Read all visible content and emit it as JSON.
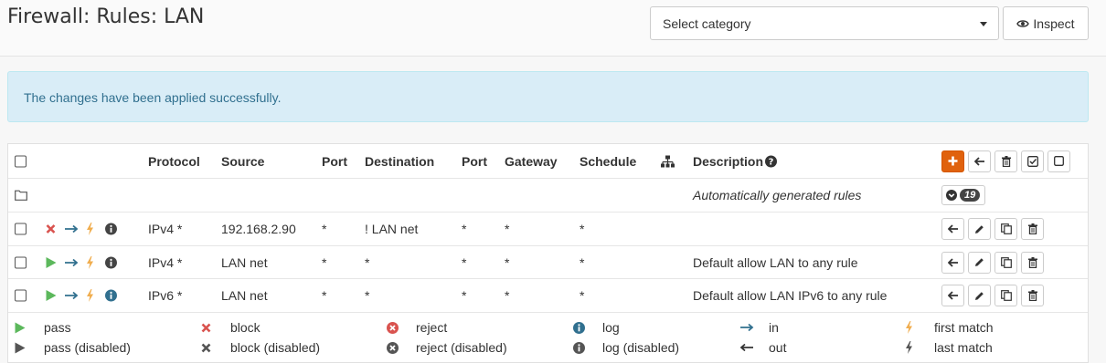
{
  "header": {
    "title": "Firewall: Rules: LAN",
    "category_placeholder": "Select category",
    "inspect_label": "Inspect"
  },
  "alert": {
    "message": "The changes have been applied successfully."
  },
  "table": {
    "columns": {
      "protocol": "Protocol",
      "source": "Source",
      "port": "Port",
      "destination": "Destination",
      "port2": "Port",
      "gateway": "Gateway",
      "schedule": "Schedule",
      "description": "Description"
    },
    "auto_rules": {
      "description": "Automatically generated rules",
      "count": "19"
    },
    "rows": [
      {
        "action": "block",
        "protocol": "IPv4 *",
        "source": "192.168.2.90",
        "port": "*",
        "destination": "! LAN net",
        "port2": "*",
        "gateway": "*",
        "schedule": "*",
        "description": ""
      },
      {
        "action": "pass",
        "protocol": "IPv4 *",
        "source": "LAN net",
        "port": "*",
        "destination": "*",
        "port2": "*",
        "gateway": "*",
        "schedule": "*",
        "description": "Default allow LAN to any rule"
      },
      {
        "action": "pass",
        "protocol": "IPv6 *",
        "source": "LAN net",
        "port": "*",
        "destination": "*",
        "port2": "*",
        "gateway": "*",
        "schedule": "*",
        "description": "Default allow LAN IPv6 to any rule"
      }
    ]
  },
  "legend": {
    "pass": "pass",
    "pass_disabled": "pass (disabled)",
    "block": "block",
    "block_disabled": "block (disabled)",
    "reject": "reject",
    "reject_disabled": "reject (disabled)",
    "log": "log",
    "log_disabled": "log (disabled)",
    "in": "in",
    "out": "out",
    "first_match": "first match",
    "last_match": "last match"
  },
  "colors": {
    "pass": "#5cb85c",
    "block": "#d9534f",
    "direction": "#31708f",
    "quick": "#f0ad4e",
    "info": "#444444",
    "info_log": "#31708f",
    "accent": "#e0620d",
    "alert_bg": "#d9edf7"
  },
  "icons": {
    "inspect": "eye-icon",
    "category_dropdown": "caret-down-icon",
    "add": "plus-icon",
    "move": "arrow-left-icon",
    "delete": "trash-icon",
    "enable": "check-square-icon",
    "disable": "square-icon",
    "edit": "pencil-icon",
    "clone": "copy-icon",
    "folder": "folder-icon",
    "expand": "chevron-down-icon",
    "gateway": "sitemap-icon",
    "help": "question-circle-icon"
  }
}
